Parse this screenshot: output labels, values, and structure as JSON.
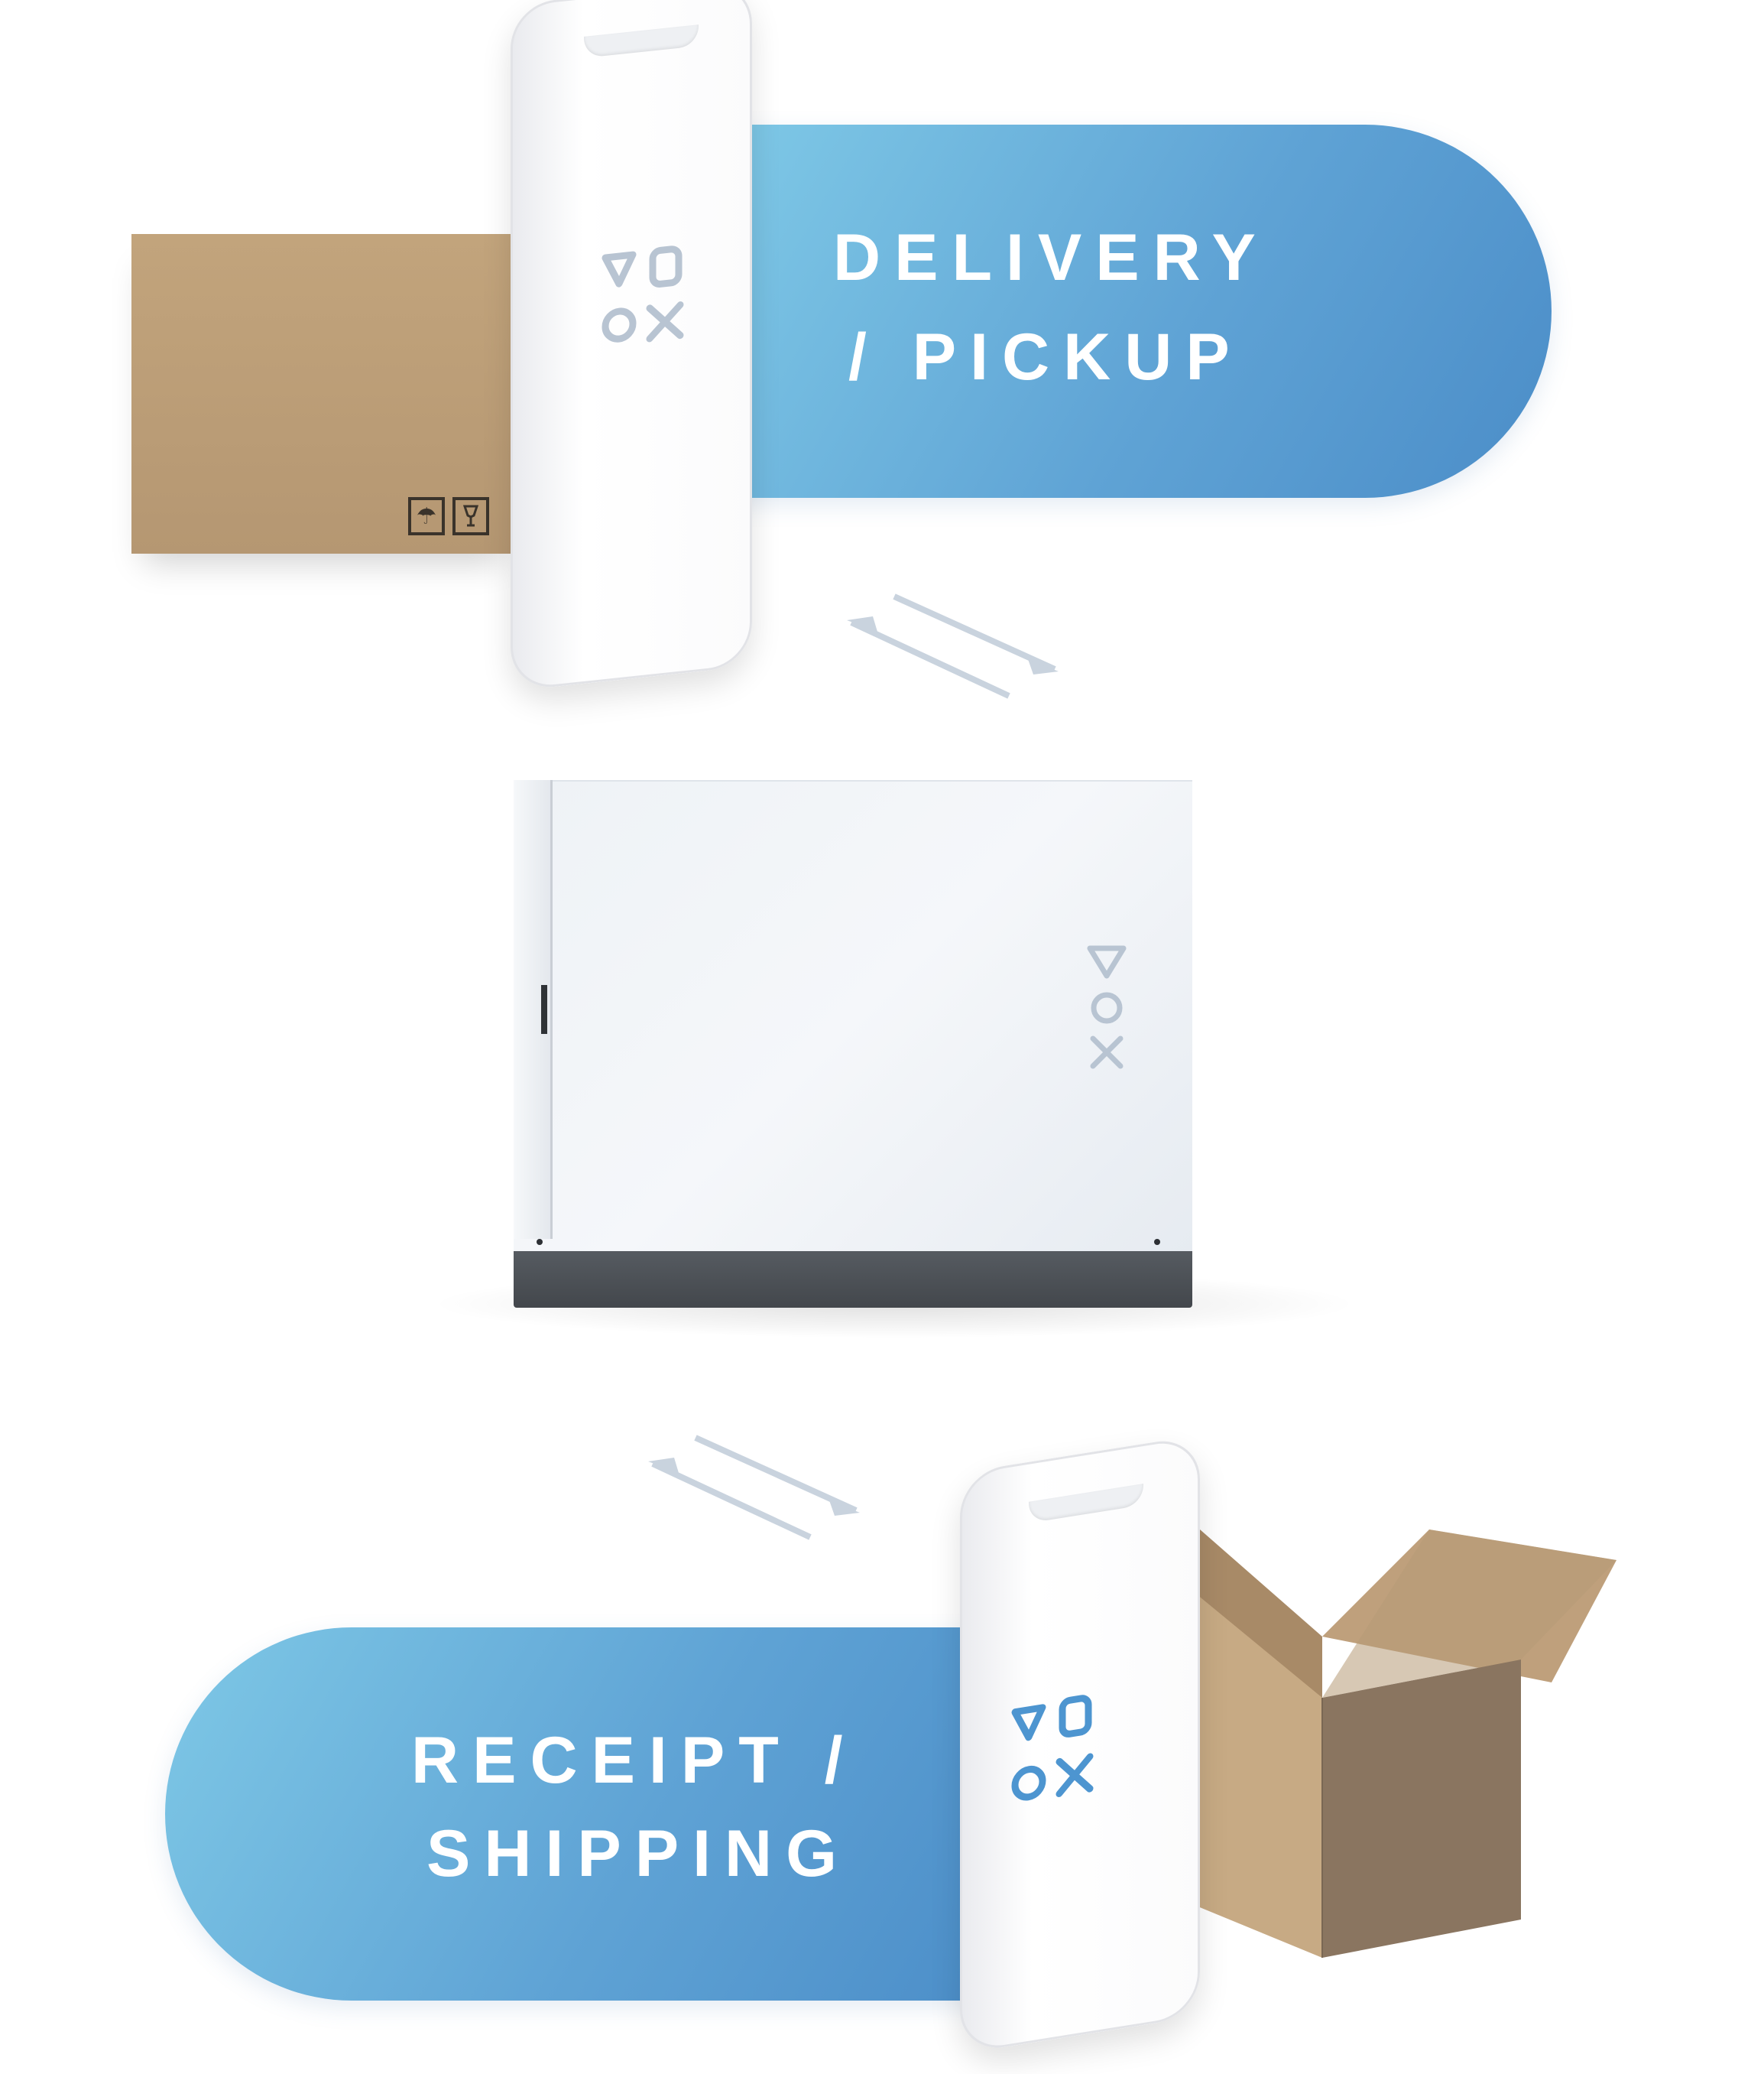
{
  "top_banner": {
    "line1": "DELIVERY",
    "line2": "/ PICKUP"
  },
  "bottom_banner": {
    "line1": "RECEIPT /",
    "line2": "SHIPPING"
  },
  "brand": {
    "logo": "vox-logo",
    "accent_color": "#5fa3d5",
    "logo_color_light": "#b8c4d2",
    "logo_color_blue": "#4d95d0"
  },
  "icons": {
    "arrows_top": "two-way-arrow-icon",
    "arrows_bottom": "two-way-arrow-icon",
    "box_symbol_1": "umbrella-icon",
    "box_symbol_2": "fragile-glass-icon"
  }
}
